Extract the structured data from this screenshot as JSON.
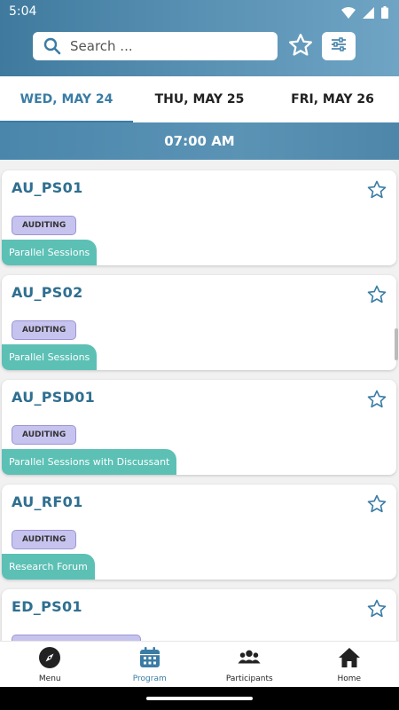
{
  "status_bar": {
    "time": "5:04"
  },
  "search": {
    "placeholder": "Search ..."
  },
  "tabs": [
    {
      "label": "WED, MAY 24",
      "active": true
    },
    {
      "label": "THU, MAY 25",
      "active": false
    },
    {
      "label": "FRI, MAY 26",
      "active": false
    }
  ],
  "time_header": "07:00 AM",
  "sessions": [
    {
      "code": "AU_PS01",
      "badge": "AUDITING",
      "type": "Parallel Sessions"
    },
    {
      "code": "AU_PS02",
      "badge": "AUDITING",
      "type": "Parallel Sessions"
    },
    {
      "code": "AU_PSD01",
      "badge": "AUDITING",
      "type": "Parallel Sessions with Discussant"
    },
    {
      "code": "AU_RF01",
      "badge": "AUDITING",
      "type": "Research Forum"
    },
    {
      "code": "ED_PS01",
      "badge": "",
      "type": ""
    }
  ],
  "nav": {
    "menu": "Menu",
    "program": "Program",
    "participants": "Participants",
    "home": "Home"
  },
  "colors": {
    "accent": "#3a7ca5",
    "title": "#2f6f90",
    "badge_bg": "#c7c3ef",
    "type_bg": "#5cc0b5"
  }
}
